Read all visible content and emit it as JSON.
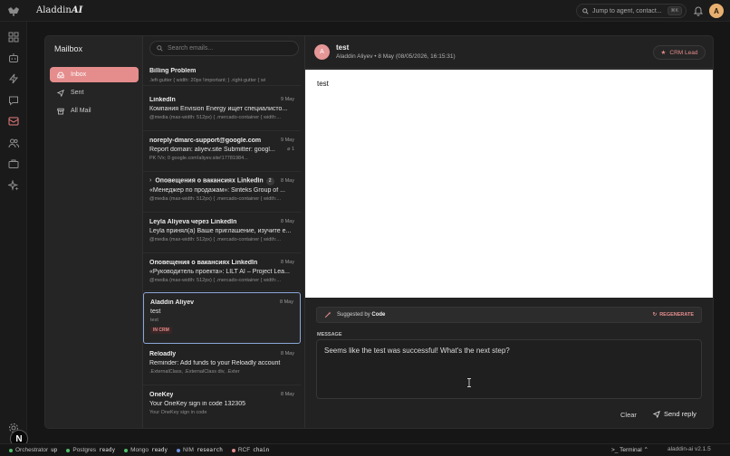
{
  "app": {
    "brand_main": "Aladdin",
    "brand_accent": "AI",
    "avatar": "A"
  },
  "topsearch": {
    "placeholder": "Jump to agent, contact...",
    "shortcut": "⌘K"
  },
  "mailbox": {
    "title": "Mailbox",
    "folders": [
      {
        "label": "Inbox",
        "icon": "inbox-icon",
        "active": true
      },
      {
        "label": "Sent",
        "icon": "send-icon",
        "active": false
      },
      {
        "label": "All Mail",
        "icon": "archive-icon",
        "active": false
      }
    ]
  },
  "list": {
    "search_placeholder": "Search emails...",
    "emails": [
      {
        "from": "Billing Problem",
        "date": "",
        "subject": "",
        "preview": ".left-gutter { width: 20px !important; } .right-gutter { wi"
      },
      {
        "from": "LinkedIn",
        "date": "9 May",
        "subject": "Компания Envision Energy ищет специалисто...",
        "preview": "@media (max-width: 512px) { .mercado-container { width:..."
      },
      {
        "from": "noreply-dmarc-support@google.com",
        "date": "9 May",
        "subject": "Report domain: aliyev.site Submitter: googl...",
        "attach": "1",
        "preview": "PK   !Vx;   0   google.com!aliyev.site!17781984..."
      },
      {
        "from": "Оповещения о вакансиях LinkedIn",
        "count": "2",
        "date": "8 May",
        "subject": "«Менеджер по продажам»: Sinteks Group of ...",
        "preview": "@media (max-width: 512px) { .mercado-container { width:..."
      },
      {
        "from": "Leyla Aliyeva через LinkedIn",
        "date": "8 May",
        "subject": "Leyla принял(а) Ваше приглашение, изучите е...",
        "preview": "@media (max-width: 512px) { .mercado-container { width:..."
      },
      {
        "from": "Оповещения о вакансиях LinkedIn",
        "date": "8 May",
        "subject": "«Руководитель проекта»: LILT AI – Project Lea...",
        "preview": "@media (max-width: 512px) { .mercado-container { width:..."
      },
      {
        "from": "Aladdin Aliyev",
        "date": "8 May",
        "subject": "test",
        "preview": "test",
        "tag": "IN CRM"
      },
      {
        "from": "Reloadly",
        "date": "8 May",
        "subject": "Reminder: Add funds to your Reloadly account",
        "preview": ".ExternalClass, .ExternalClass div, .Exter"
      },
      {
        "from": "OneKey",
        "date": "8 May",
        "subject": "Your OneKey sign in code 132305",
        "preview": "Your OneKey sign in code"
      }
    ]
  },
  "reader": {
    "avatar": "A",
    "subject": "test",
    "meta": "Aladdin Aliyev • 8 May (08/05/2026, 16:15:31)",
    "crm_label": "CRM Lead",
    "body": "test",
    "suggested_prefix": "Suggested by",
    "suggested_by": "Code",
    "regenerate": "REGENERATE",
    "message_label": "MESSAGE",
    "message": "Seems like the test was successful! What's the next step?",
    "clear": "Clear",
    "send": "Send reply"
  },
  "status": {
    "items": [
      {
        "name": "Orchestrator",
        "state": "up",
        "color": "#4fbf6a"
      },
      {
        "name": "Postgres",
        "state": "ready",
        "color": "#4fbf6a"
      },
      {
        "name": "Mongo",
        "state": "ready",
        "color": "#4fbf6a"
      },
      {
        "name": "NIM",
        "state": "research",
        "color": "#6a8fe0"
      },
      {
        "name": "RCF",
        "state": "chain",
        "color": "#e58c8c"
      }
    ],
    "terminal": "Terminal",
    "app_name": "aladdin-ai",
    "version": "v2.1.5"
  },
  "colors": {
    "accent": "#e58c8c",
    "selected_border": "#8aa7d8"
  }
}
